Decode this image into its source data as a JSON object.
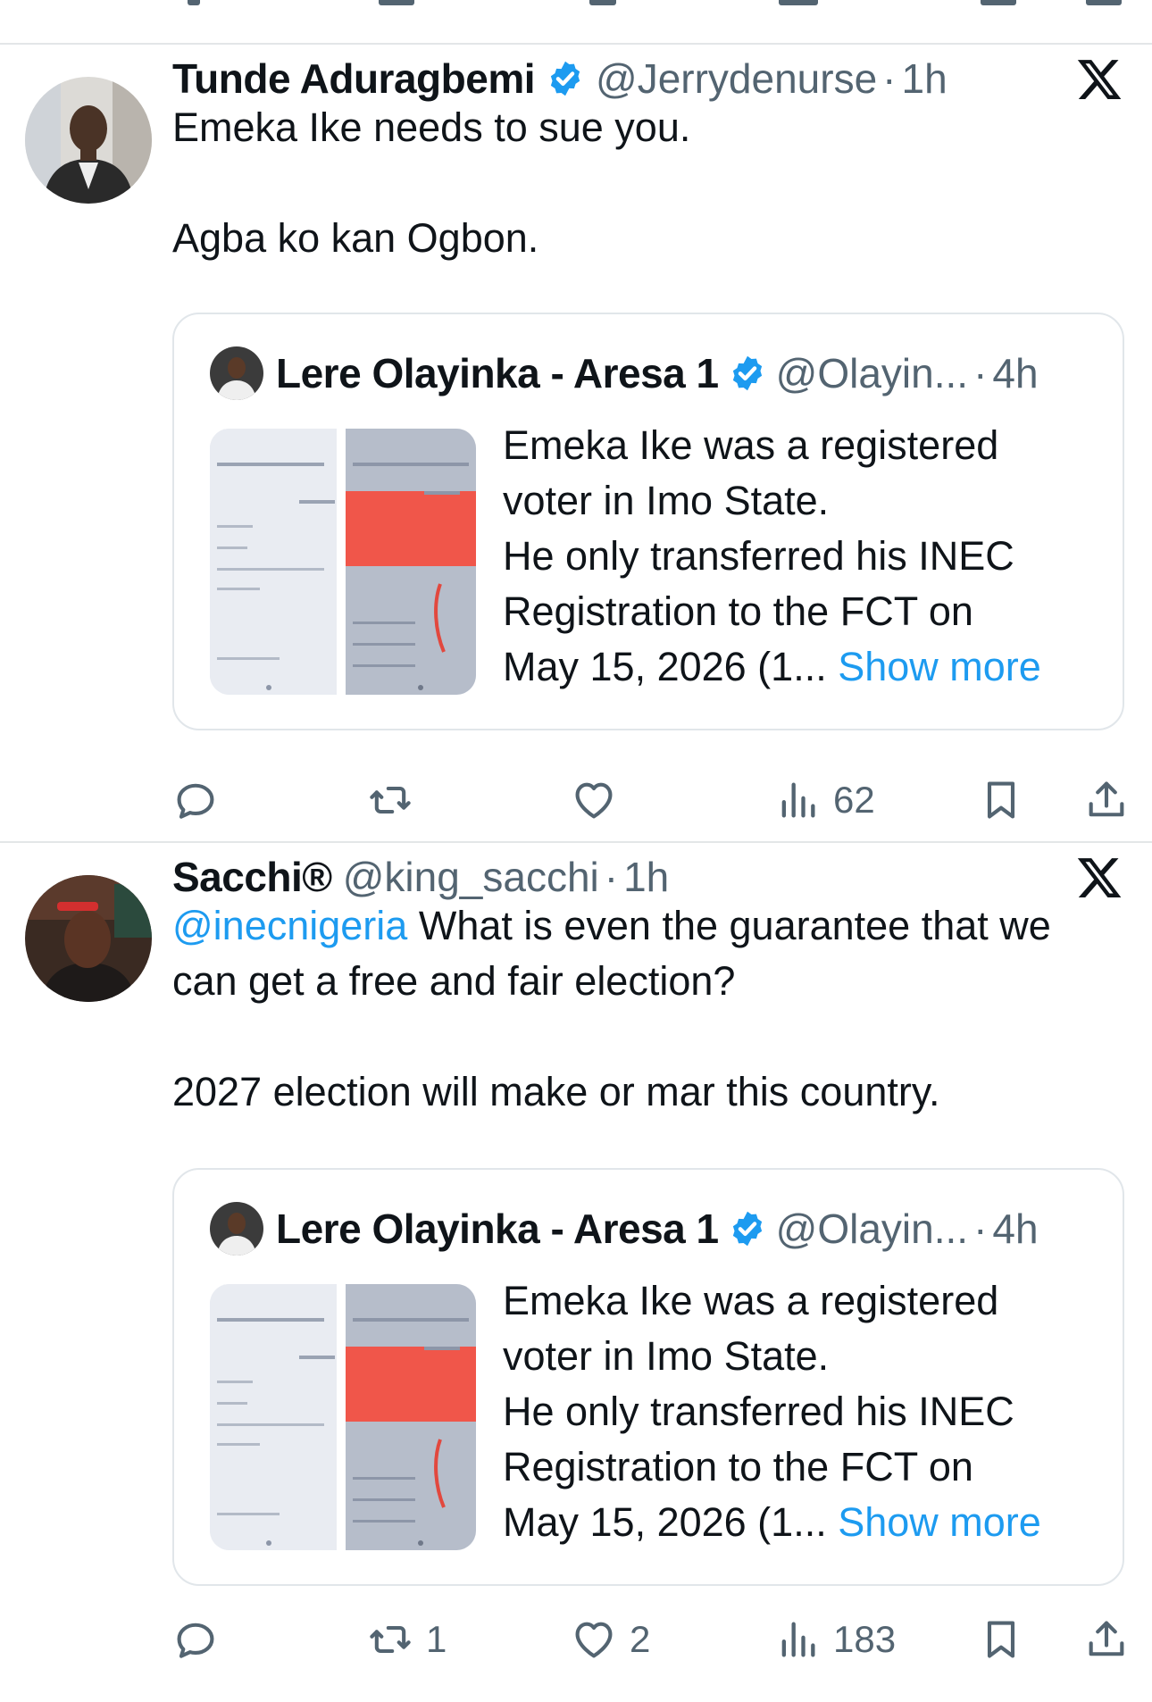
{
  "tweets": [
    {
      "author": {
        "name": "Tunde Aduragbemi",
        "verified": true,
        "handle": "@Jerrydenurse",
        "time": "1h"
      },
      "text": [
        "Emeka Ike needs to sue you.",
        "Agba ko kan Ogbon."
      ],
      "mention": "",
      "quote": {
        "author": {
          "name": "Lere Olayinka - Aresa 1",
          "verified": true,
          "handle": "@Olayin...",
          "time": "4h"
        },
        "lines": [
          "Emeka Ike was a registered",
          "voter in Imo State.",
          "He only transferred his INEC",
          "Registration to the FCT on"
        ],
        "last_line": "May 15, 2026 (1...",
        "show_more": "Show more"
      },
      "actions": {
        "reply": "",
        "repost": "",
        "like": "",
        "views": "62"
      }
    },
    {
      "author": {
        "name": "Sacchi®",
        "verified": false,
        "handle": "@king_sacchi",
        "time": "1h"
      },
      "mention": "@inecnigeria",
      "text_after_mention": "What is even the guarantee that we",
      "text_line2": "can get a free and fair election?",
      "text_para2": "2027 election will make or mar this country.",
      "quote": {
        "author": {
          "name": "Lere Olayinka - Aresa 1",
          "verified": true,
          "handle": "@Olayin...",
          "time": "4h"
        },
        "lines": [
          "Emeka Ike was a registered",
          "voter in Imo State.",
          "He only transferred his INEC",
          "Registration to the FCT on"
        ],
        "last_line": "May 15, 2026 (1...",
        "show_more": "Show more"
      },
      "actions": {
        "reply": "",
        "repost": "1",
        "like": "2",
        "views": "183"
      }
    }
  ],
  "separator": "·",
  "colors": {
    "link": "#1d9bf0",
    "secondary": "#536471",
    "text": "#0f1419",
    "verified": "#1d9bf0",
    "divider": "#e3e6e8"
  },
  "icons": [
    "verified-badge-icon",
    "x-logo-icon",
    "reply-icon",
    "repost-icon",
    "like-icon",
    "views-icon",
    "bookmark-icon",
    "share-icon"
  ]
}
